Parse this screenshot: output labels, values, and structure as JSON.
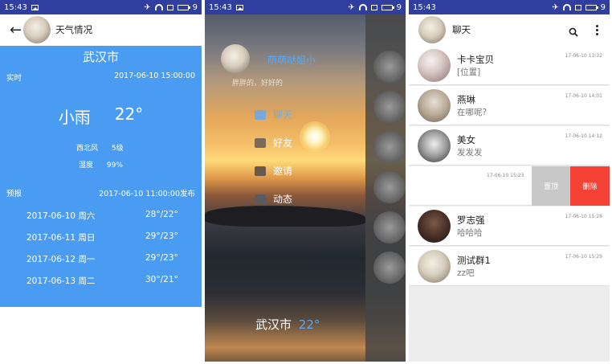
{
  "status_bar": {
    "time": "15:43",
    "battery": "9"
  },
  "weather": {
    "title": "天气情况",
    "city": "武汉市",
    "realtime_label": "实时",
    "realtime_time": "2017-06-10 15:00:00",
    "condition": "小雨",
    "temp": "22°",
    "wind_label": "西北风",
    "wind_value": "5级",
    "humidity_label": "湿度",
    "humidity_value": "99%",
    "forecast_label": "预报",
    "forecast_time": "2017-06-10 11:00:00发布",
    "forecast": [
      {
        "date": "2017-06-10 周六",
        "temp": "28°/22°"
      },
      {
        "date": "2017-06-11 周日",
        "temp": "29°/23°"
      },
      {
        "date": "2017-06-12 周一",
        "temp": "29°/23°"
      },
      {
        "date": "2017-06-13 周二",
        "temp": "30°/21°"
      }
    ],
    "accent_color": "#4a9cf3"
  },
  "drawer": {
    "username": "萌萌哒姐小",
    "signature": "胖胖的，好好的",
    "menu": [
      {
        "label": "聊天",
        "icon": "chat-icon"
      },
      {
        "label": "好友",
        "icon": "friends-icon"
      },
      {
        "label": "邀请",
        "icon": "invite-icon"
      },
      {
        "label": "动态",
        "icon": "moments-icon"
      }
    ],
    "city": "武汉市",
    "temp": "22°"
  },
  "chat": {
    "title": "聊天",
    "conversations": [
      {
        "name": "卡卡宝贝",
        "message": "[位置]",
        "time": "17-06-10 13:32"
      },
      {
        "name": "燕琳",
        "message": "在哪呢?",
        "time": "17-06-10 14:01"
      },
      {
        "name": "美女",
        "message": "发发发",
        "time": "17-06-10 14:12"
      },
      {
        "name": "",
        "message": "",
        "time": "17-06-10 15:23"
      },
      {
        "name": "罗志强",
        "message": "哈哈哈",
        "time": "17-06-10 15:28"
      },
      {
        "name": "测试群1",
        "message": "zz吧",
        "time": "17-06-10 15:29"
      }
    ],
    "pin_label": "置顶",
    "delete_label": "删除",
    "pin_color": "#c8c8c8",
    "delete_color": "#f44336"
  }
}
